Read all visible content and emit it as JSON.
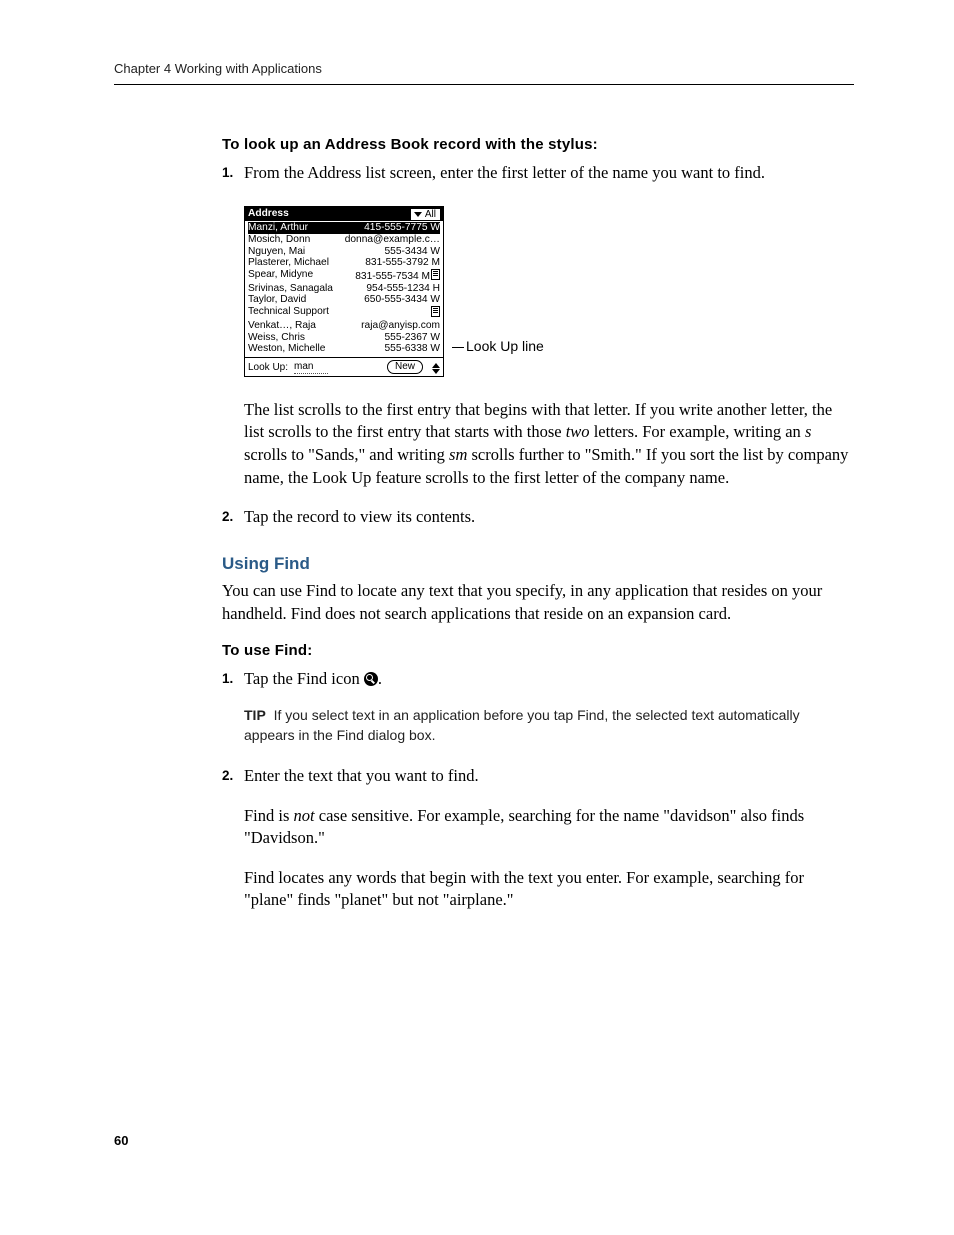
{
  "running_head": "Chapter 4   Working with Applications",
  "page_number": "60",
  "proc1_title": "To look up an Address Book record with the stylus:",
  "step1_num": "1.",
  "step1_text": "From the Address list screen, enter the first letter of the name you want to find.",
  "callout": "Look Up line",
  "afterfig_para_a": "The list scrolls to the first entry that begins with that letter. If you write another letter, the list scrolls to the first entry that starts with those ",
  "afterfig_para_b_italic": "two",
  "afterfig_para_c": " letters. For example, writing an ",
  "afterfig_para_d_italic": "s",
  "afterfig_para_e": " scrolls to \"Sands,\" and writing ",
  "afterfig_para_f_italic": "sm",
  "afterfig_para_g": " scrolls further to \"Smith.\" If you sort the list by company name, the Look Up feature scrolls to the first letter of the company name.",
  "step2_num": "2.",
  "step2_text": "Tap the record to view its contents.",
  "h3": "Using Find",
  "find_intro": "You can use Find to locate any text that you specify, in any application that resides on your handheld. Find does not search applications that reside on an expansion card.",
  "proc2_title": "To use Find:",
  "f_step1_num": "1.",
  "f_step1_a": "Tap the Find icon ",
  "f_step1_b": ".",
  "tip_label": "TIP",
  "tip_text": "If you select text in an application before you tap Find, the selected text automatically appears in the Find dialog box.",
  "f_step2_num": "2.",
  "f_step2_text": "Enter the text that you want to find.",
  "f_para2_a": "Find is ",
  "f_para2_b_italic": "not",
  "f_para2_c": " case sensitive. For example, searching for the name \"davidson\" also finds \"Davidson.\"",
  "f_para3": "Find locates any words that begin with the text you enter. For example, searching for \"plane\" finds \"planet\" but not \"airplane.\"",
  "device": {
    "title": "Address",
    "category": "All",
    "rows": [
      {
        "l": "Manzi, Arthur",
        "r": "415-555-7775 W",
        "sel": true
      },
      {
        "l": "Mosich, Donn",
        "r": "donna@example.c…"
      },
      {
        "l": "Nguyen, Mai",
        "r": "555-3434 W"
      },
      {
        "l": "Plasterer, Michael",
        "r": "831-555-3792 M"
      },
      {
        "l": "Spear, Midyne",
        "r": "831-555-7534 M",
        "note": true
      },
      {
        "l": "Srivinas, Sanagala",
        "r": "954-555-1234 H"
      },
      {
        "l": "Taylor, David",
        "r": "650-555-3434 W"
      },
      {
        "l": "Technical Support",
        "r": "",
        "note": true
      },
      {
        "l": "Venkat…, Raja",
        "r": "raja@anyisp.com"
      },
      {
        "l": "Weiss, Chris",
        "r": "555-2367 W"
      },
      {
        "l": "Weston, Michelle",
        "r": "555-6338 W"
      }
    ],
    "lookup_label": "Look Up:",
    "lookup_value": "man",
    "new_btn": "New"
  }
}
